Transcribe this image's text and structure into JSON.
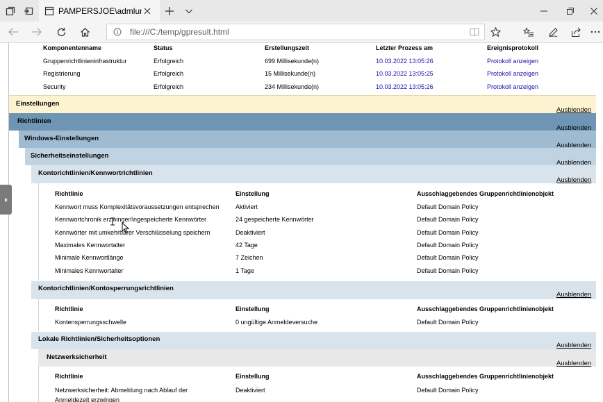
{
  "browser": {
    "tab_title": "PAMPERSJOE\\admlump",
    "url": "file:///C:/temp/gpresult.html",
    "colors": {
      "titlebar": "#e8e8e8",
      "tab": "#f5f5f5"
    }
  },
  "components": {
    "headers": [
      "Komponentenname",
      "Status",
      "Erstellungszeit",
      "Letzter Prozess am",
      "Ereignisprotokoll"
    ],
    "rows": [
      {
        "name": "Gruppenrichtlinieninfrastruktur",
        "status": "Erfolgreich",
        "time": "699 Millisekunde(n)",
        "last": "10.03.2022 13:05:26",
        "log": "Protokoll anzeigen"
      },
      {
        "name": "Registrierung",
        "status": "Erfolgreich",
        "time": "15 Millisekunde(n)",
        "last": "10.03.2022 13:05:25",
        "log": "Protokoll anzeigen"
      },
      {
        "name": "Security",
        "status": "Erfolgreich",
        "time": "234 Millisekunde(n)",
        "last": "10.03.2022 13:05:26",
        "log": "Protokoll anzeigen"
      }
    ]
  },
  "hide_label": "Ausblenden",
  "sections": {
    "einstellungen": "Einstellungen",
    "richtlinien": "Richtlinien",
    "windows": "Windows-Einstellungen",
    "sicherheit": "Sicherheitseinstellungen",
    "kennwort": "Kontorichtlinien/Kennwortrichtlinien",
    "kontosperrung": "Kontorichtlinien/Kontosperrungsrichtlinien",
    "lokale": "Lokale Richtlinien/Sicherheitsoptionen",
    "netzwerk": "Netzwerksicherheit"
  },
  "policy_headers": [
    "Richtlinie",
    "Einstellung",
    "Ausschlaggebendes Gruppenrichtlinienobjekt"
  ],
  "kennwort_rows": [
    {
      "policy": "Kennwort muss Komplexitätsvoraussetzungen entsprechen",
      "setting": "Aktiviert",
      "gpo": "Default Domain Policy"
    },
    {
      "policy": "Kennwortchronik erzwingen\\ngespeicherte Kennwörter",
      "setting": "24 gespeicherte Kennwörter",
      "gpo": "Default Domain Policy"
    },
    {
      "policy": "Kennwörter mit umkehrbarer Verschlüsselung speichern",
      "setting": "Deaktiviert",
      "gpo": "Default Domain Policy"
    },
    {
      "policy": "Maximales Kennwortalter",
      "setting": "42 Tage",
      "gpo": "Default Domain Policy"
    },
    {
      "policy": "Minimale Kennwortlänge",
      "setting": "7 Zeichen",
      "gpo": "Default Domain Policy"
    },
    {
      "policy": "Minimales Kennwortalter",
      "setting": "1 Tage",
      "gpo": "Default Domain Policy"
    }
  ],
  "kontosperrung_rows": [
    {
      "policy": "Kontensperrungsschwelle",
      "setting": "0 ungültige Anmeldeversuche",
      "gpo": "Default Domain Policy"
    }
  ],
  "netzwerk_rows": [
    {
      "policy": "Netzwerksicherheit: Abmeldung nach Ablauf der",
      "policy_line2": "Anmeldezeit erzwingen",
      "setting": "Deaktiviert",
      "gpo": "Default Domain Policy"
    }
  ],
  "colors": {
    "einstellungen": "#fdf3d0",
    "richtlinien": "#6f95b5",
    "windows": "#9fbbd2",
    "sicherheit": "#bfd3e3",
    "sub": "#d8e3ec",
    "netzwerk": "#e8e8e8",
    "link": "#1a0dab"
  }
}
